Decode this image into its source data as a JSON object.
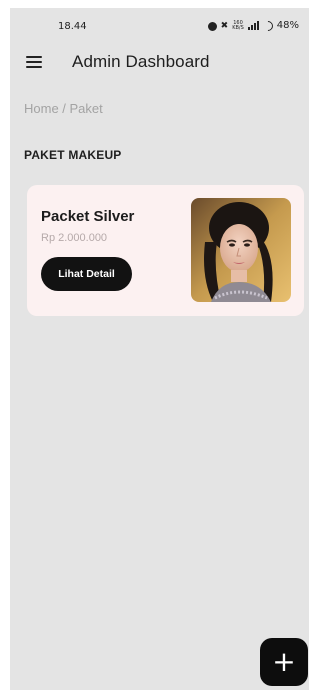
{
  "status_bar": {
    "time": "18.44",
    "speed_top": "160",
    "speed_bottom": "KB/S",
    "network": "4G",
    "battery": "48%"
  },
  "app_bar": {
    "menu_icon": "hamburger-menu-icon",
    "title": "Admin Dashboard"
  },
  "breadcrumb": "Home / Paket",
  "section_title": "PAKET MAKEUP",
  "packages": [
    {
      "title": "Packet Silver",
      "price": "Rp 2.000.000",
      "button_label": "Lihat Detail",
      "image": "makeup-model-photo"
    }
  ],
  "fab": {
    "icon": "plus-icon",
    "label": "+"
  },
  "colors": {
    "background": "#e4e4e4",
    "card": "#fcf1f1",
    "button": "#121212",
    "fab": "#0d0d0d"
  }
}
